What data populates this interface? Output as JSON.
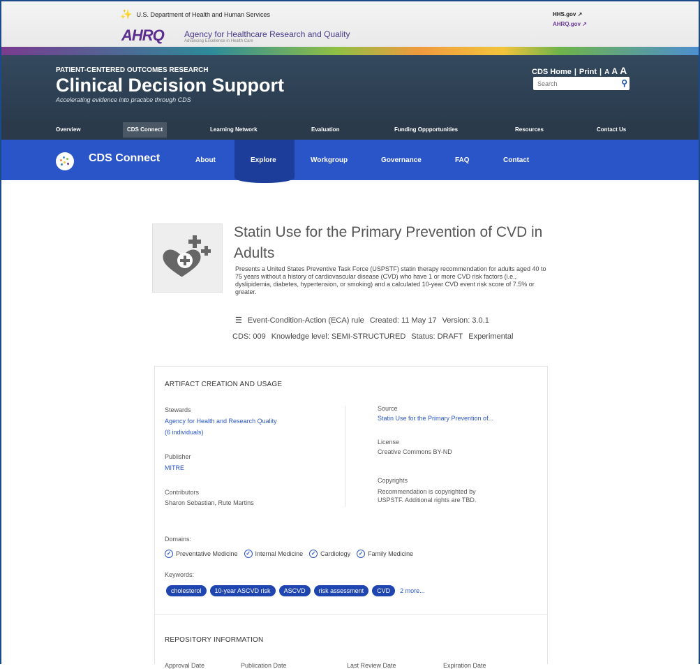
{
  "hhs": {
    "dept": "U.S. Department of Health and Human Services",
    "logo": "AHRQ",
    "agency": "Agency for Healthcare Research and Quality",
    "tagline": "Advancing Excellence in Health Care",
    "link1": "HHS.gov",
    "link2": "AHRQ.gov",
    "external_icon": "external-link-icon"
  },
  "header": {
    "kicker": "PATIENT-CENTERED OUTCOMES RESEARCH",
    "title": "Clinical Decision Support",
    "tagline": "Accelerating evidence into practice through CDS",
    "cds_home": "CDS Home",
    "print": "Print",
    "aa": [
      "A",
      "A",
      "A"
    ],
    "search_placeholder": "Search"
  },
  "nav": [
    "Overview",
    "CDS Connect",
    "Learning Network",
    "Evaluation",
    "Funding Oppportunities",
    "Resources",
    "Contact Us"
  ],
  "cds_connect": {
    "name": "CDS Connect",
    "items": [
      "About",
      "Explore",
      "Workgroup",
      "Governance",
      "FAQ",
      "Contact"
    ]
  },
  "artifact": {
    "title": "Statin Use for the Primary Prevention of CVD in Adults",
    "description": "Presents a United States Preventive Task Force (USPSTF) statin therapy recommendation for adults aged 40 to 75 years without a history of cardiovascular disease (CVD) who have 1 or more CVD risk factors (i.e., dyslipidemia, diabetes, hypertension, or smoking) and a calculated 10-year CVD event risk score of 7.5% or greater.",
    "type": "Event-Condition-Action (ECA) rule",
    "created": "Created: 11 May 17",
    "version": "Version: 3.0.1",
    "cds": "CDS: 009",
    "knowledge": "Knowledge level: SEMI-STRUCTURED",
    "status": "Status: DRAFT",
    "experimental": "Experimental"
  },
  "card": {
    "heading": "ARTIFACT CREATION AND USAGE",
    "stewards_label": "Stewards",
    "stewards_value": "Agency for Health and Research Quality",
    "stewards_count": "(6 individuals)",
    "publisher_label": "Publisher",
    "publisher_value": "MITRE",
    "contributors_label": "Contributors",
    "contributors_value": "Sharon Sebastian, Rute Martins",
    "source_label": "Source",
    "source_value": "Statin Use for the Primary Prevention of...",
    "license_label": "License",
    "license_value": "Creative Commons BY-ND",
    "copyrights_label": "Copyrights",
    "copyrights_line1": "Recommendation is copyrighted by",
    "copyrights_line2": "USPSTF. Additional rights are TBD.",
    "domains_label": "Domains:",
    "domains": [
      "Preventative Medicine",
      "Internal Medicine",
      "Cardiology",
      "Family Medicine"
    ],
    "keywords_label": "Keywords:",
    "keywords": [
      "cholesterol",
      "10-year ASCVD risk",
      "ASCVD",
      "risk assessment",
      "CVD"
    ],
    "more": "2 more...",
    "repo_heading": "REPOSITORY INFORMATION",
    "repo_cols": [
      "Approval Date",
      "Publication Date",
      "Last Review Date",
      "Expiration Date"
    ]
  }
}
